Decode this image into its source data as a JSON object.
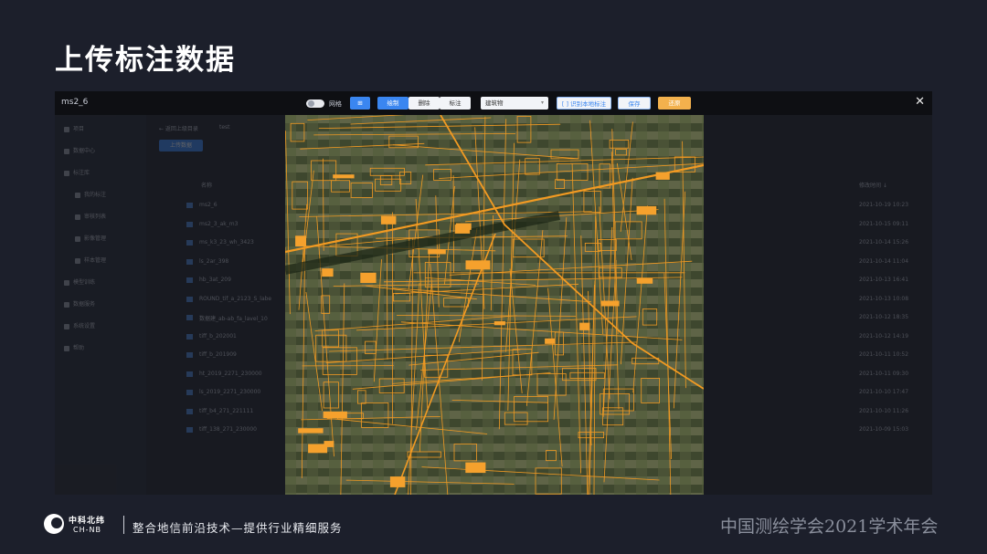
{
  "slide": {
    "title": "上传标注数据"
  },
  "window": {
    "title": "ms2_6",
    "close_symbol": "✕",
    "grid_toggle_label": "网格",
    "toolbar": {
      "icon_button": "⊞",
      "draw_label": "绘制",
      "delete_label": "删除",
      "label_label": "标注",
      "select_value": "建筑物",
      "select_caret": "▾",
      "recognize_label": "[ ] 识别本地标注",
      "save_label": "保存",
      "reset_label": "还原"
    }
  },
  "background_app": {
    "sidebar_items": [
      "项目",
      "数据中心",
      "标注库",
      "我的标注",
      "审核列表",
      "影像管理",
      "样本管理",
      "模型训练",
      "数据服务",
      "系统设置",
      "帮助"
    ],
    "breadcrumb": "← 返回上级目录",
    "breadcrumb_folder": "test",
    "upload_button": "上传数据",
    "col_name": "名称",
    "col_date": "修改时间 ↓",
    "files": [
      {
        "name": "ms2_6",
        "date": "2021-10-19 10:23"
      },
      {
        "name": "ms2_3_ak_m3",
        "date": "2021-10-15 09:11"
      },
      {
        "name": "ms_k3_23_wh_3423",
        "date": "2021-10-14 15:26"
      },
      {
        "name": "ls_2ar_398",
        "date": "2021-10-14 11:04"
      },
      {
        "name": "hb_3at_209",
        "date": "2021-10-13 16:41"
      },
      {
        "name": "ROUND_tif_a_2123_S_labe",
        "date": "2021-10-13 10:08"
      },
      {
        "name": "数据建_ab-ab_fa_lavel_10",
        "date": "2021-10-12 18:35"
      },
      {
        "name": "tiff_b_202001",
        "date": "2021-10-12 14:19"
      },
      {
        "name": "tiff_b_201909",
        "date": "2021-10-11 10:52"
      },
      {
        "name": "ht_2019_2271_230000",
        "date": "2021-10-11 09:30"
      },
      {
        "name": "ls_2019_2271_230000",
        "date": "2021-10-10 17:47"
      },
      {
        "name": "tiff_b4_271_221111",
        "date": "2021-10-10 11:26"
      },
      {
        "name": "tiff_138_271_230000",
        "date": "2021-10-09 15:03"
      }
    ]
  },
  "footer": {
    "brand_cn": "中科北纬",
    "brand_en": "CH-NB",
    "slogan": "整合地信前沿技术—提供行业精细服务",
    "conference": "中国测绘学会2021学术年会"
  },
  "colors": {
    "slide_bg": "#1c1f2b",
    "annotation_orange": "#f29a22",
    "primary_blue": "#3a86f0",
    "reset_orange": "#f3b14d"
  }
}
